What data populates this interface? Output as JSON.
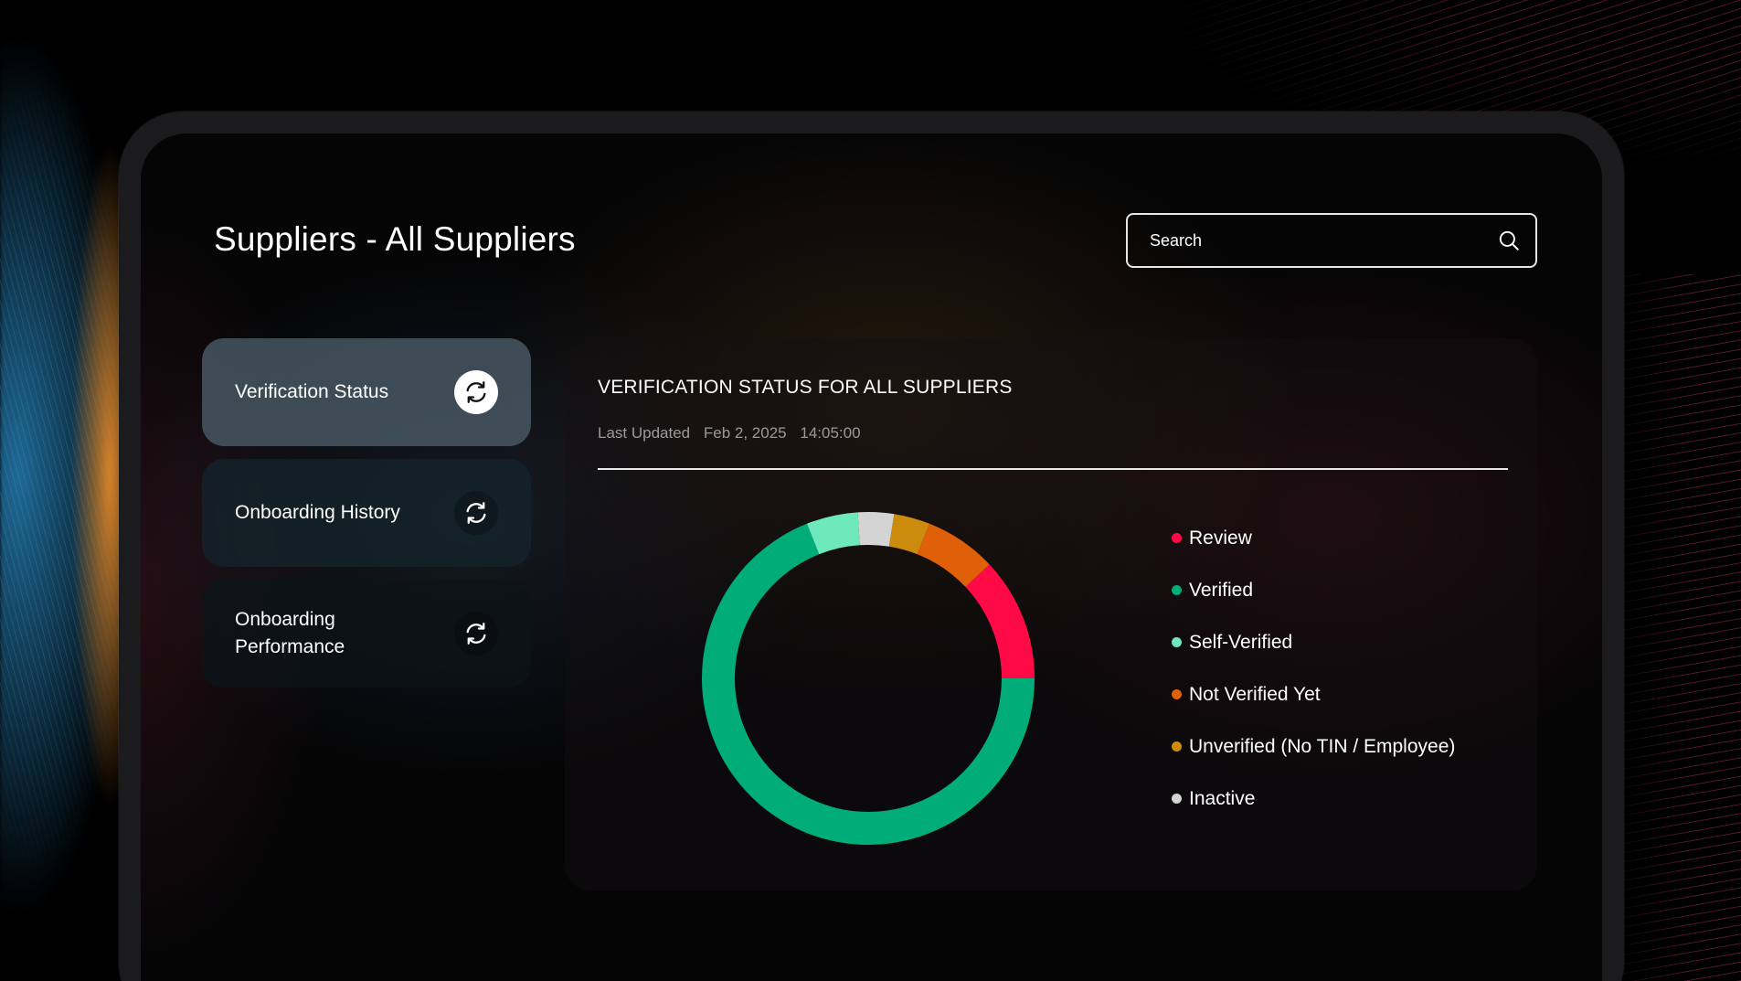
{
  "page": {
    "title": "Suppliers - All Suppliers"
  },
  "search": {
    "placeholder": "Search"
  },
  "nav": {
    "items": [
      {
        "label": "Verification Status",
        "active": true
      },
      {
        "label": "Onboarding History",
        "active": false
      },
      {
        "label": "Onboarding Performance",
        "active": false
      }
    ]
  },
  "panel": {
    "title": "VERIFICATION STATUS FOR ALL SUPPLIERS",
    "updated_label": "Last Updated",
    "updated_date": "Feb 2, 2025",
    "updated_time": "14:05:00"
  },
  "chart_data": {
    "type": "pie",
    "donut": true,
    "categories": [
      "Review",
      "Verified",
      "Self-Verified",
      "Not Verified Yet",
      "Unverified (No TIN / Employee)",
      "Inactive"
    ],
    "values": [
      12,
      69,
      5,
      7,
      3.5,
      3.5
    ],
    "colors": [
      "#ff0a47",
      "#00ad79",
      "#6ee8bd",
      "#e0600a",
      "#cc8b0d",
      "#d4d4d4"
    ],
    "legend_position": "right"
  }
}
